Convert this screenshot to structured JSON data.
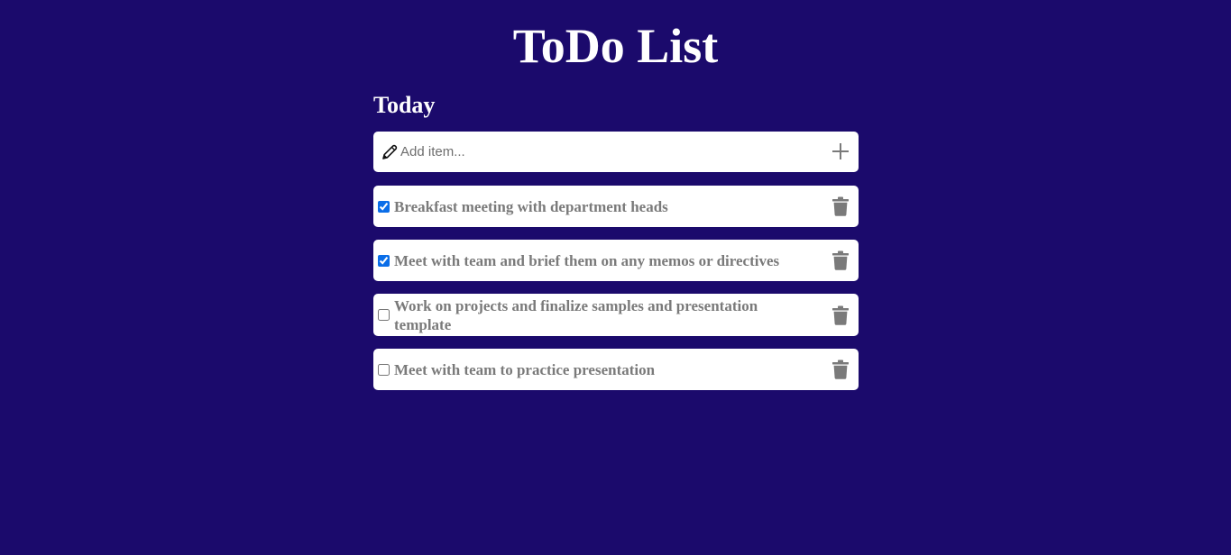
{
  "title": "ToDo List",
  "section": "Today",
  "add_item": {
    "placeholder": "Add item...",
    "value": ""
  },
  "colors": {
    "background": "#1b0a6c",
    "card": "#ffffff",
    "item_text": "#7a7a7a",
    "icon": "#7a7a7a",
    "checkbox_accent": "#0b6ee8"
  },
  "items": [
    {
      "text": "Breakfast meeting with department heads",
      "checked": true
    },
    {
      "text": "Meet with team and brief them on any memos or directives",
      "checked": true
    },
    {
      "text": "Work on projects and finalize samples and presentation template",
      "checked": false
    },
    {
      "text": "Meet with team to practice presentation",
      "checked": false
    }
  ]
}
